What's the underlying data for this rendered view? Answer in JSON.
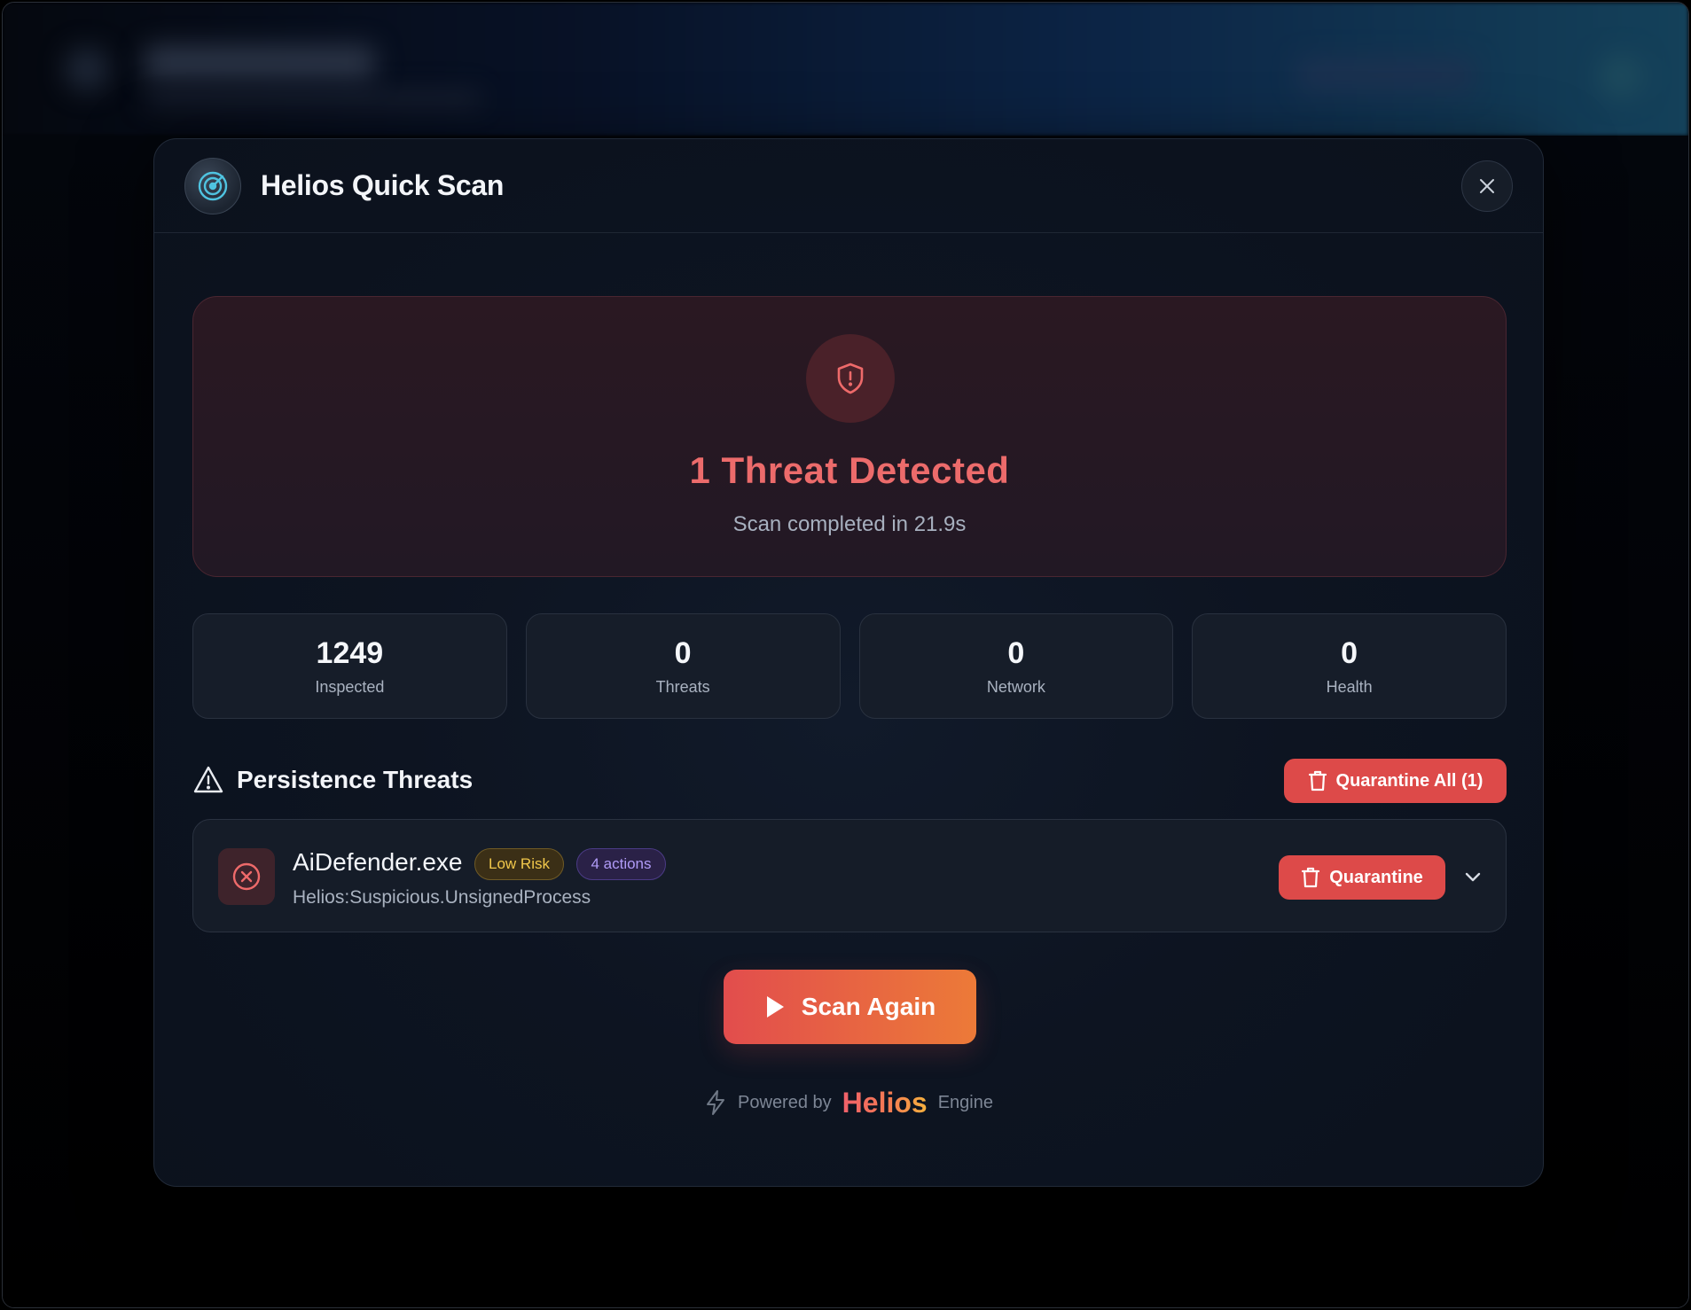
{
  "modal": {
    "title": "Helios Quick Scan"
  },
  "alert": {
    "title": "1 Threat Detected",
    "subtitle": "Scan completed in 21.9s"
  },
  "stats": [
    {
      "value": "1249",
      "label": "Inspected"
    },
    {
      "value": "0",
      "label": "Threats"
    },
    {
      "value": "0",
      "label": "Network"
    },
    {
      "value": "0",
      "label": "Health"
    }
  ],
  "section": {
    "title": "Persistence Threats",
    "quarantine_all_label": "Quarantine All (1)"
  },
  "threats": [
    {
      "name": "AiDefender.exe",
      "risk": "Low Risk",
      "actions": "4 actions",
      "signature": "Helios:Suspicious.UnsignedProcess",
      "quarantine_label": "Quarantine"
    }
  ],
  "scan_again_label": "Scan Again",
  "footer": {
    "powered_by": "Powered by",
    "brand": "Helios",
    "engine": "Engine"
  },
  "colors": {
    "danger": "#dd4a49",
    "alert_text": "#ec6b6b",
    "accent_cyan": "#4fc3e0",
    "warning": "#f2c84b",
    "purple": "#b09bf7"
  },
  "icons": {
    "logo": "radar-icon",
    "close": "close-icon",
    "alert": "shield-alert-icon",
    "section": "warning-triangle-icon",
    "quarantine": "trash-icon",
    "threat": "x-circle-icon",
    "expand": "chevron-down-icon",
    "scan": "play-icon",
    "powered": "lightning-icon"
  }
}
